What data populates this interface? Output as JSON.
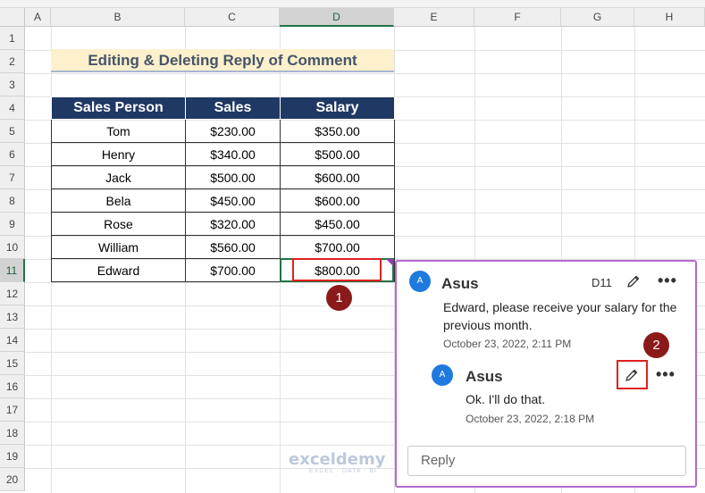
{
  "columns": [
    "A",
    "B",
    "C",
    "D",
    "E",
    "F",
    "G",
    "H"
  ],
  "rows": [
    "1",
    "2",
    "3",
    "4",
    "5",
    "6",
    "7",
    "8",
    "9",
    "10",
    "11",
    "12",
    "13",
    "14",
    "15",
    "16",
    "17",
    "18",
    "19",
    "20"
  ],
  "title": "Editing & Deleting Reply of Comment",
  "table": {
    "headers": [
      "Sales Person",
      "Sales",
      "Salary"
    ],
    "rows": [
      [
        "Tom",
        "$230.00",
        "$350.00"
      ],
      [
        "Henry",
        "$340.00",
        "$500.00"
      ],
      [
        "Jack",
        "$500.00",
        "$600.00"
      ],
      [
        "Bela",
        "$450.00",
        "$600.00"
      ],
      [
        "Rose",
        "$320.00",
        "$450.00"
      ],
      [
        "William",
        "$560.00",
        "$700.00"
      ],
      [
        "Edward",
        "$700.00",
        "$800.00"
      ]
    ]
  },
  "badges": {
    "one": "1",
    "two": "2"
  },
  "comment": {
    "avatar": "A",
    "author": "Asus",
    "cell_ref": "D11",
    "text": "Edward, please receive your salary for the previous month.",
    "date": "October 23, 2022, 2:11 PM",
    "more": "•••"
  },
  "reply": {
    "avatar": "A",
    "author": "Asus",
    "text": "Ok. I'll do that.",
    "date": "October 23, 2022, 2:18 PM",
    "more": "•••"
  },
  "reply_box": {
    "placeholder": "Reply"
  },
  "watermark": {
    "brand": "exceldemy",
    "tagline": "EXCEL · DATA · BI"
  },
  "colors": {
    "header_bg": "#203864",
    "title_bg": "#fdf0cc",
    "accent_green": "#217346",
    "panel_border": "#b36bd1",
    "badge": "#8b1a1a",
    "highlight": "#e02020"
  },
  "icons": {
    "edit": "pencil-icon",
    "more": "more-options-icon"
  }
}
